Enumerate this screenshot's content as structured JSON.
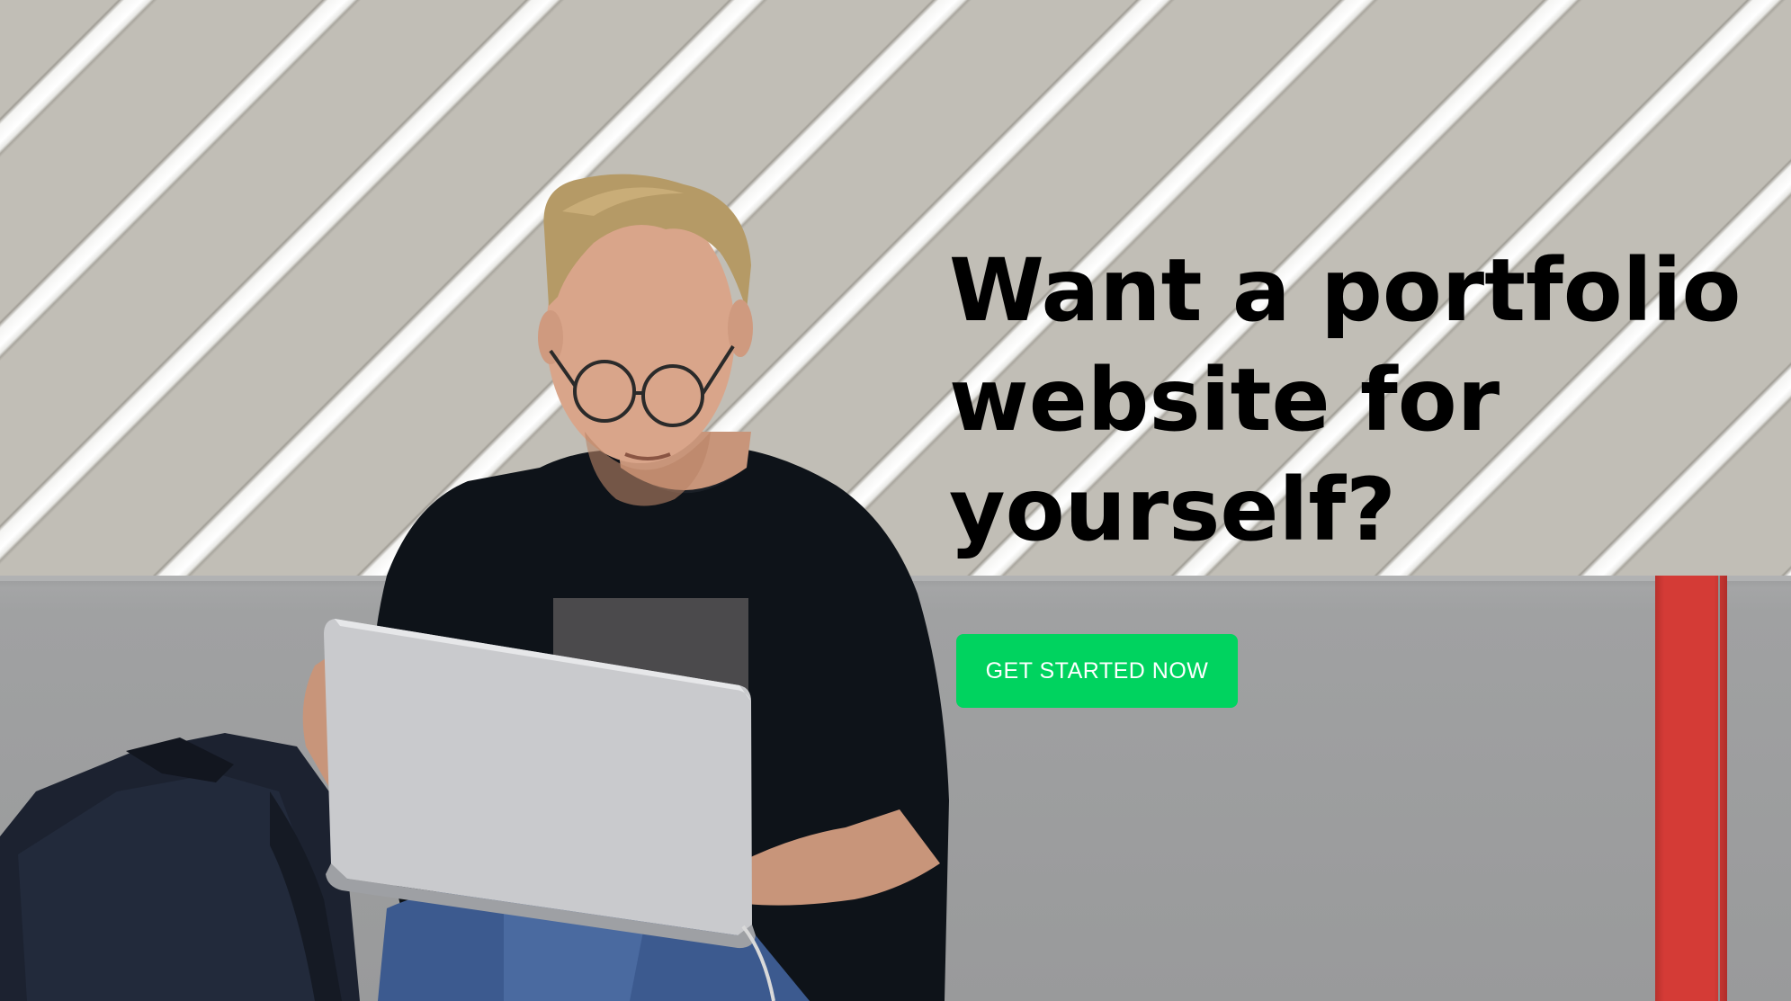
{
  "hero": {
    "headline": "Want a portfolio website for yourself?",
    "cta_label": "GET STARTED NOW"
  },
  "colors": {
    "cta_background": "#00d35f",
    "cta_text": "#ffffff",
    "headline_text": "#000000",
    "bench_stripe": "#d43b36"
  },
  "icons": {
    "photo": "man-with-laptop-photo"
  }
}
